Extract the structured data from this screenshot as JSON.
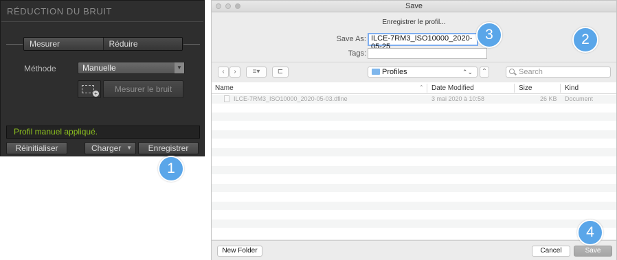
{
  "panel": {
    "title": "RÉDUCTION DU BRUIT",
    "tabs": [
      "Mesurer",
      "Réduire"
    ],
    "method_label": "Méthode",
    "method_value": "Manuelle",
    "measure_button": "Mesurer le bruit",
    "status": "Profil manuel appliqué.",
    "reset_button": "Réinitialiser",
    "load_button": "Charger",
    "save_button": "Enregistrer"
  },
  "badges": [
    "1",
    "2",
    "3",
    "4"
  ],
  "dialog": {
    "title": "Save",
    "prompt": "Enregistrer le profil...",
    "save_as_label": "Save As:",
    "save_as_value": "ILCE-7RM3_ISO10000_2020-05-25",
    "tags_label": "Tags:",
    "location": "Profiles",
    "search_placeholder": "Search",
    "columns": {
      "name": "Name",
      "date": "Date Modified",
      "size": "Size",
      "kind": "Kind"
    },
    "files": [
      {
        "name": "ILCE-7RM3_ISO10000_2020-05-03.dfine",
        "date": "3 mai 2020 à 10:58",
        "size": "26 KB",
        "kind": "Document"
      }
    ],
    "new_folder_button": "New Folder",
    "cancel_button": "Cancel",
    "save_button": "Save"
  },
  "colors": {
    "panel_bg": "#2e2e2e",
    "status_green": "#8ec21f",
    "badge_blue": "#5aa6e9",
    "focus_ring": "#7eaef0"
  }
}
